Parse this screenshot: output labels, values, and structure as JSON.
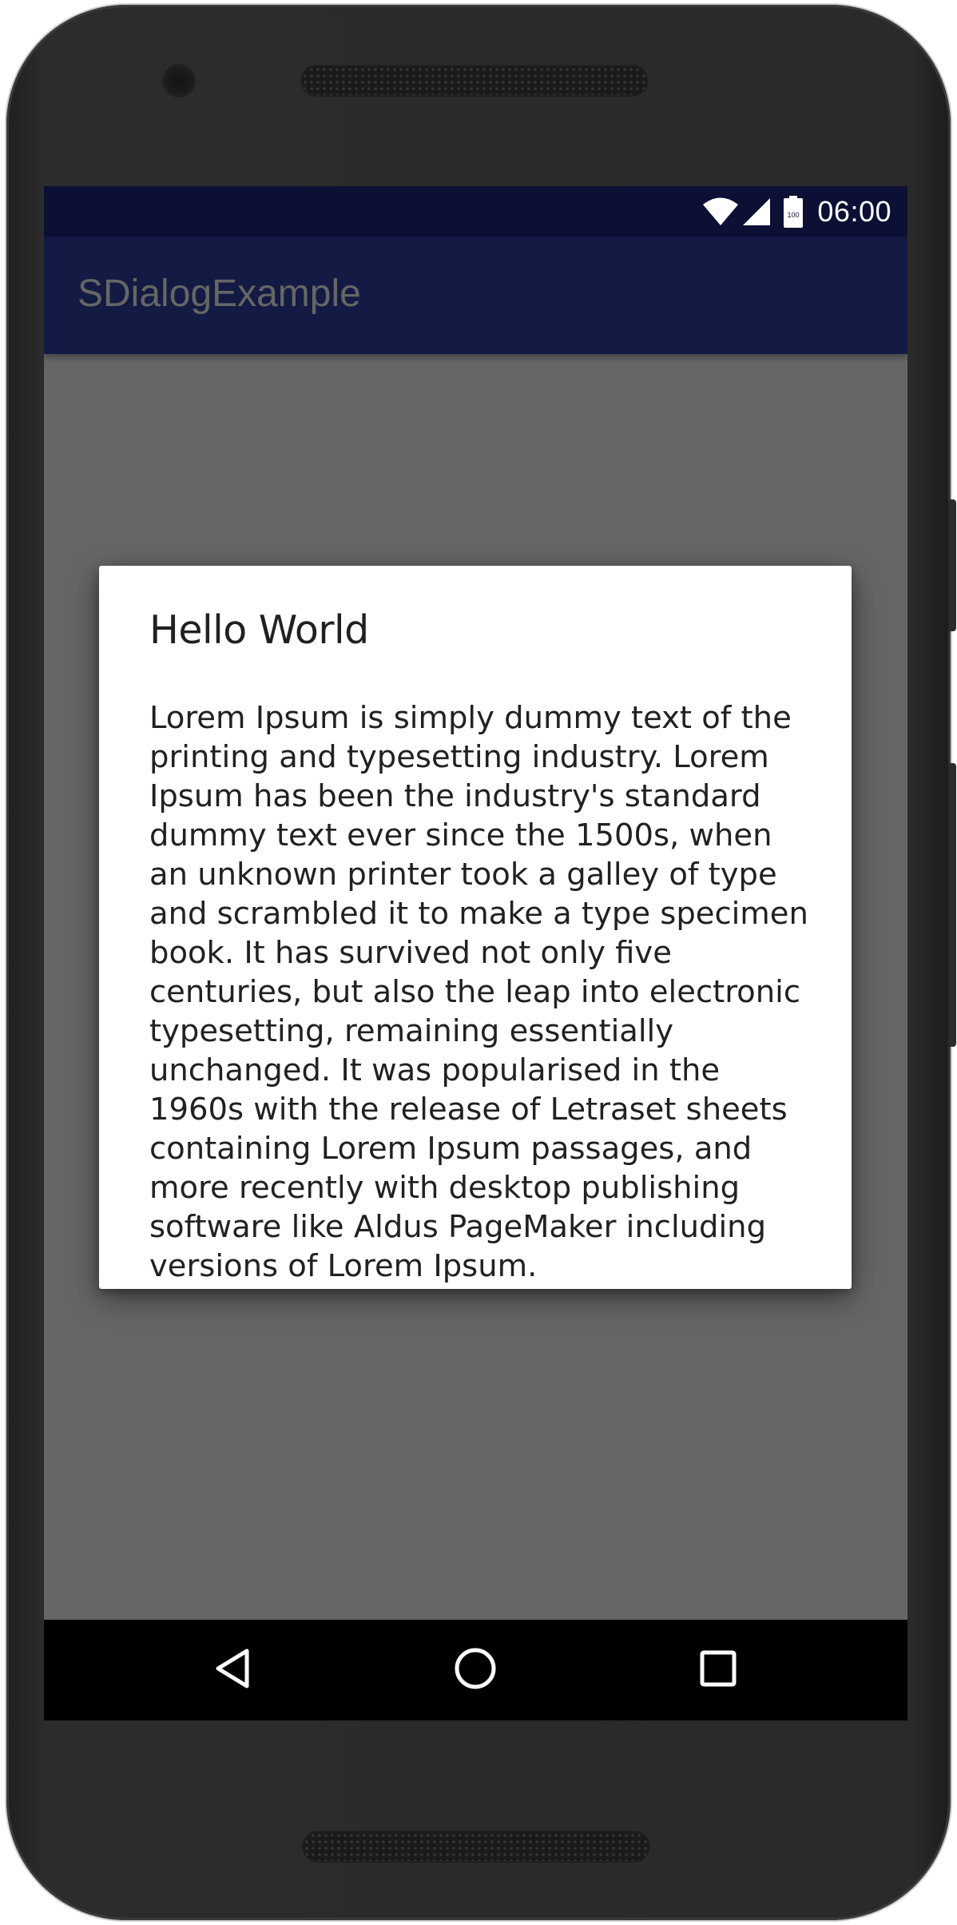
{
  "status_bar": {
    "time": "06:00",
    "battery_level": "100",
    "icons": [
      "wifi-icon",
      "cellular-signal-icon",
      "battery-icon"
    ]
  },
  "app_bar": {
    "title": "SDialogExample"
  },
  "dialog": {
    "title": "Hello World",
    "message": "Lorem Ipsum is simply dummy text of the printing and typesetting industry. Lorem Ipsum has been the industry's standard dummy text ever since the 1500s, when an unknown printer took a galley of type and scrambled it to make a type specimen book. It has survived not only five centuries, but also the leap into electronic typesetting, remaining essentially unchanged. It was popularised in the 1960s with the release of Letraset sheets containing Lorem Ipsum passages, and more recently with desktop publishing software like Aldus PageMaker including versions of Lorem Ipsum."
  },
  "nav_bar": {
    "buttons": [
      "back-icon",
      "home-icon",
      "recent-apps-icon"
    ]
  },
  "colors": {
    "status_bar": "#0c1034",
    "app_bar": "#131a43",
    "scrim": "#666666",
    "dialog_background": "#ffffff",
    "text": "#212121",
    "nav_bar": "#000000"
  }
}
